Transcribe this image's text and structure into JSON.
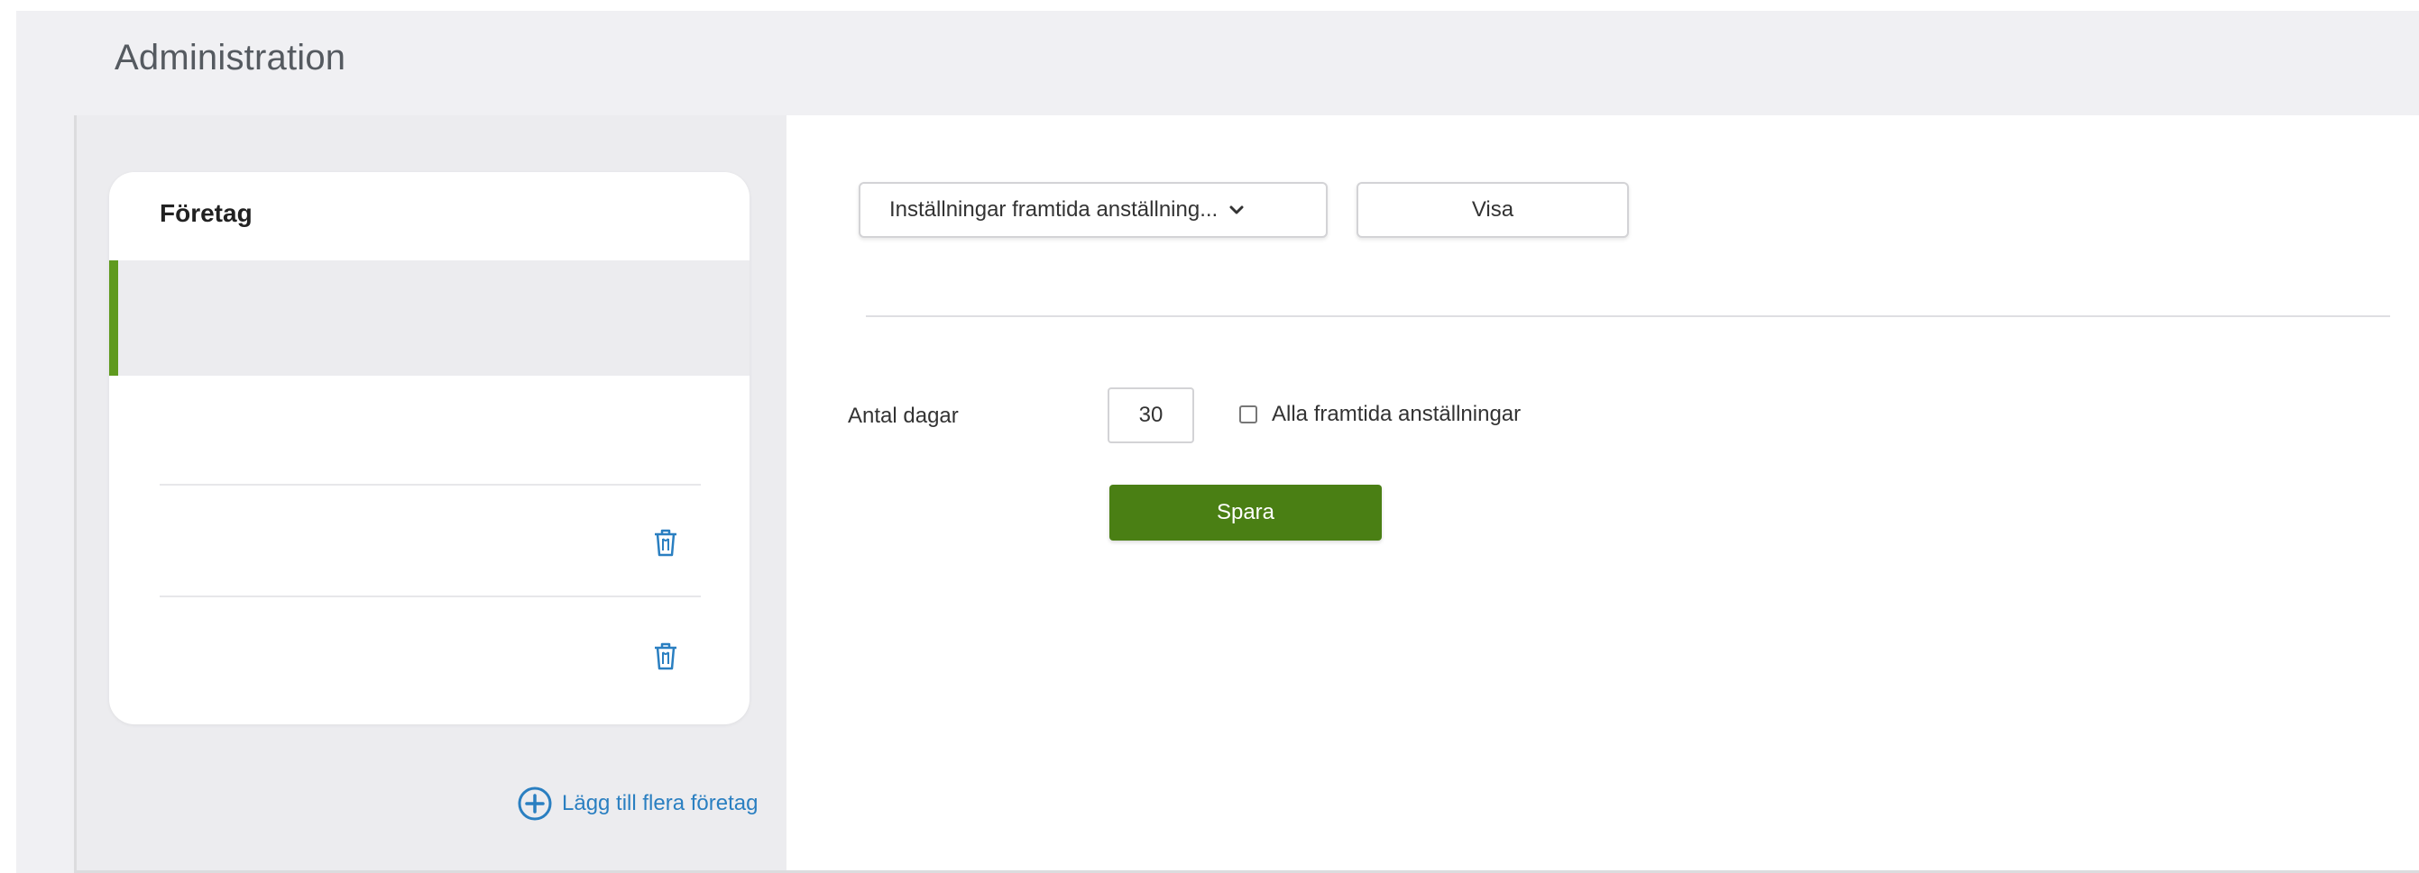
{
  "page": {
    "title": "Administration"
  },
  "companies": {
    "title": "Företag",
    "add_label": "Lägg till flera företag",
    "accent_color": "#5f9a1e"
  },
  "settings": {
    "select_value": "Inställningar framtida anställning...",
    "show_label": "Visa"
  },
  "form": {
    "days_label": "Antal dagar",
    "days_value": "30",
    "all_future_label": "Alla framtida anställningar",
    "save_label": "Spara",
    "save_color": "#4a7f14"
  },
  "icons": {
    "delete": "trash-icon",
    "add": "plus-circle-icon",
    "dropdown": "chevron-down-icon"
  }
}
